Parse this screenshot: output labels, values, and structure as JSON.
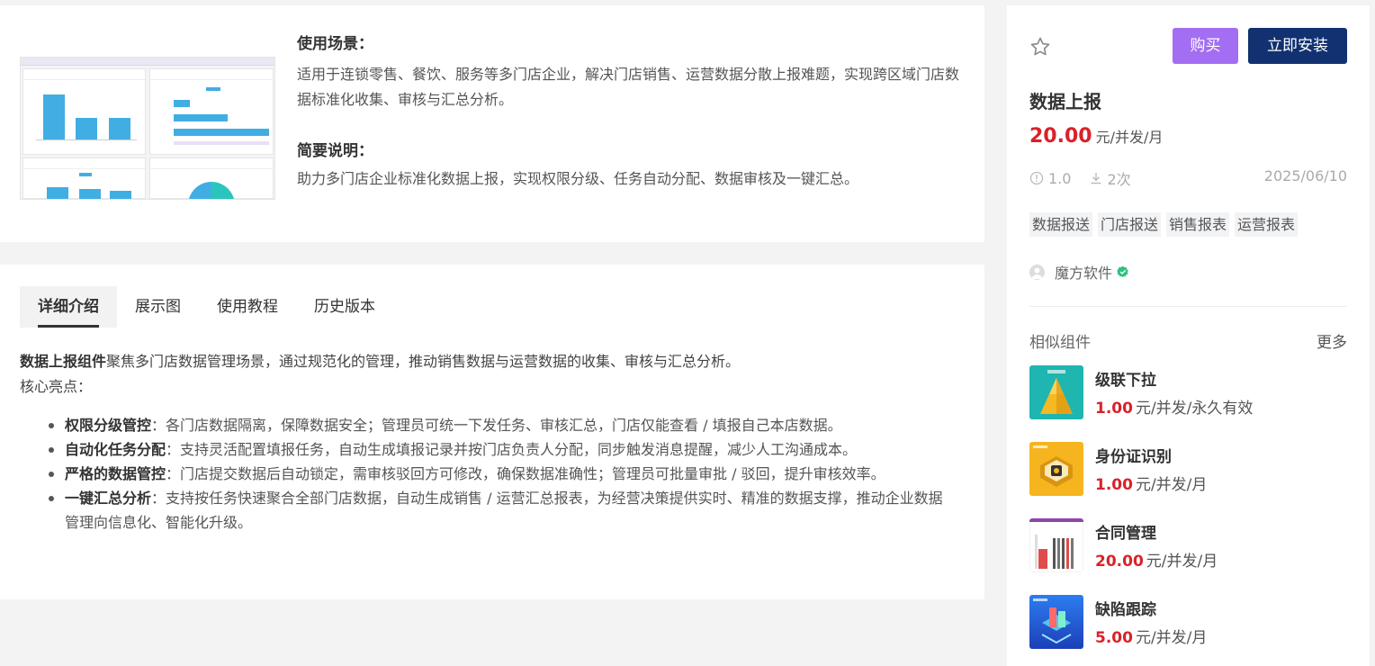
{
  "overview": {
    "scene_title": "使用场景：",
    "scene_text": "适用于连锁零售、餐饮、服务等多门店企业，解决门店销售、运营数据分散上报难题，实现跨区域门店数据标准化收集、审核与汇总分析。",
    "brief_title": "简要说明：",
    "brief_text": "助力多门店企业标准化数据上报，实现权限分级、任务自动分配、数据审核及一键汇总。"
  },
  "tabs": [
    {
      "label": "详细介绍",
      "active": true
    },
    {
      "label": "展示图",
      "active": false
    },
    {
      "label": "使用教程",
      "active": false
    },
    {
      "label": "历史版本",
      "active": false
    }
  ],
  "detail": {
    "intro_bold": "数据上报组件",
    "intro_text": "聚焦多门店数据管理场景，通过规范化的管理，推动销售数据与运营数据的收集、审核与汇总分析。",
    "highlights_label": "核心亮点：",
    "bullets": [
      {
        "title": "权限分级管控",
        "text": "：各门店数据隔离，保障数据安全；管理员可统一下发任务、审核汇总，门店仅能查看 / 填报自己本店数据。"
      },
      {
        "title": "自动化任务分配",
        "text": "：支持灵活配置填报任务，自动生成填报记录并按门店负责人分配，同步触发消息提醒，减少人工沟通成本。"
      },
      {
        "title": "严格的数据管控",
        "text": "：门店提交数据后自动锁定，需审核驳回方可修改，确保数据准确性；管理员可批量审批 / 驳回，提升审核效率。"
      },
      {
        "title": "一键汇总分析",
        "text": "：支持按任务快速聚合全部门店数据，自动生成销售 / 运营汇总报表，为经营决策提供实时、精准的数据支撑，推动企业数据管理向信息化、智能化升级。"
      }
    ]
  },
  "product": {
    "buy_label": "购买",
    "install_label": "立即安装",
    "title": "数据上报",
    "price": "20.00",
    "price_unit": "元/并发/月",
    "version": "1.0",
    "downloads": "2次",
    "date": "2025/06/10",
    "tags": [
      "数据报送",
      "门店报送",
      "销售报表",
      "运营报表"
    ],
    "vendor": "魔方软件"
  },
  "similar": {
    "title": "相似组件",
    "more": "更多",
    "items": [
      {
        "name": "级联下拉",
        "price": "1.00",
        "unit": "元/并发/永久有效"
      },
      {
        "name": "身份证识别",
        "price": "1.00",
        "unit": "元/并发/月"
      },
      {
        "name": "合同管理",
        "price": "20.00",
        "unit": "元/并发/月"
      },
      {
        "name": "缺陷跟踪",
        "price": "5.00",
        "unit": "元/并发/月"
      }
    ]
  },
  "colors": {
    "buy": "#a36ef1",
    "install": "#113170",
    "price": "#d9222a",
    "verified": "#2ec27e"
  }
}
